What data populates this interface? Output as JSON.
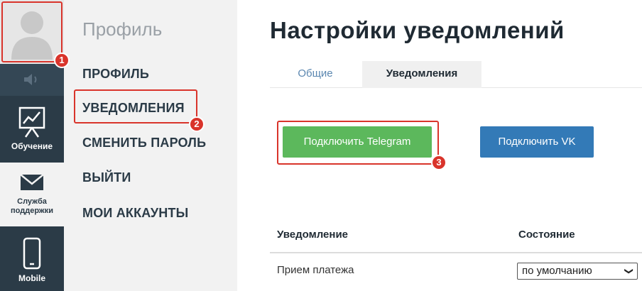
{
  "sidebar": {
    "learn_label": "Обучение",
    "support_label": "Служба поддержки",
    "mobile_label": "Mobile"
  },
  "profile_menu": {
    "title": "Профиль",
    "items": [
      {
        "label": "ПРОФИЛЬ"
      },
      {
        "label": "УВЕДОМЛЕНИЯ"
      },
      {
        "label": "СМЕНИТЬ ПАРОЛЬ"
      },
      {
        "label": "ВЫЙТИ"
      },
      {
        "label": "МОИ АККАУНТЫ"
      }
    ]
  },
  "main": {
    "title": "Настройки уведомлений",
    "tabs": [
      {
        "label": "Общие",
        "active": false
      },
      {
        "label": "Уведомления",
        "active": true
      }
    ],
    "buttons": {
      "telegram": "Подключить Telegram",
      "vk": "Подключить VK"
    },
    "table": {
      "headers": [
        "Уведомление",
        "Состояние"
      ],
      "rows": [
        {
          "name": "Прием платежа",
          "state": "по умолчанию"
        }
      ]
    }
  },
  "annotations": [
    "1",
    "2",
    "3"
  ],
  "colors": {
    "rail": "#2b3b47",
    "panel": "#f2f2f2",
    "telegram_button": "#5cb85c",
    "vk_button": "#337ab7",
    "highlight": "#d9342b",
    "tab_link": "#5b87b0"
  }
}
